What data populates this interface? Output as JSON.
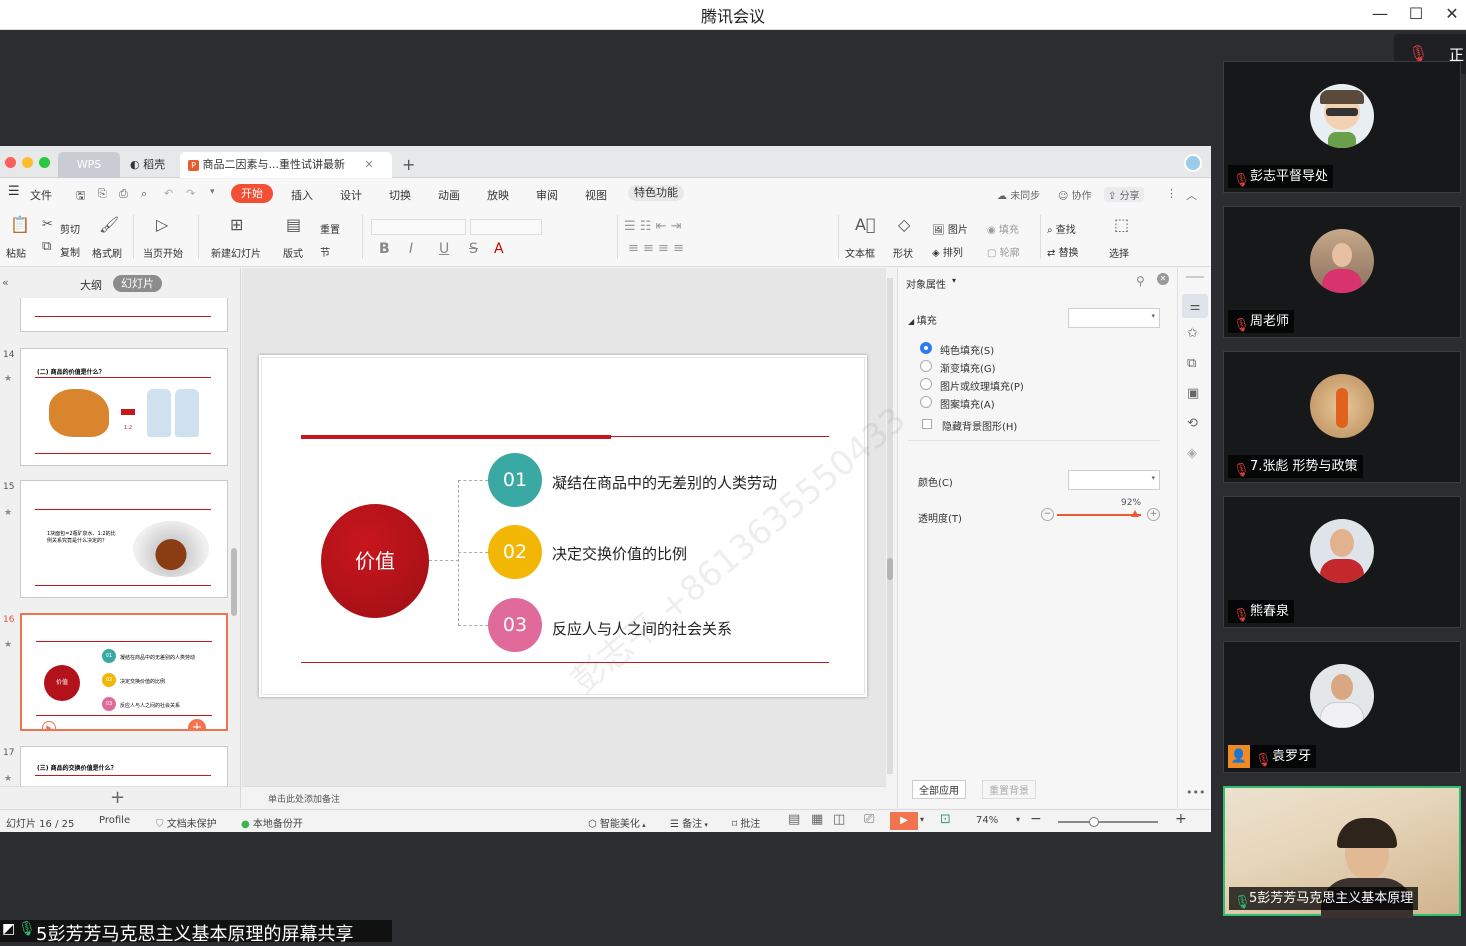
{
  "window": {
    "title": "腾讯会议",
    "minimize": "—",
    "maximize": "☐",
    "close": "✕"
  },
  "topright": {
    "label": "正"
  },
  "wps": {
    "tabs": {
      "wps": "WPS",
      "daoke": "稻壳",
      "doc": "商品二因素与...重性试讲最新",
      "add": "+"
    },
    "menu": {
      "file": "文件",
      "start": "开始",
      "insert": "插入",
      "design": "设计",
      "transition": "切换",
      "animation": "动画",
      "show": "放映",
      "review": "审阅",
      "view": "视图",
      "special": "特色功能",
      "unsync": "未同步",
      "collab": "协作",
      "share": "分享"
    },
    "toolbar": {
      "paste": "粘贴",
      "cut": "剪切",
      "copy": "复制",
      "format_painter": "格式刷",
      "from_current": "当页开始",
      "new_slide": "新建幻灯片",
      "layout": "版式",
      "reset": "重置",
      "section": "节",
      "textbox": "文本框",
      "shape": "形状",
      "picture": "图片",
      "arrange": "排列",
      "fill": "填充",
      "outline": "轮廓",
      "find": "查找",
      "replace": "替换",
      "select": "选择"
    },
    "leftpane": {
      "outline": "大纲",
      "slides": "幻灯片",
      "n14": "14",
      "n15": "15",
      "n16": "16",
      "n17": "17",
      "t14": "(二) 商品的价值是什么？",
      "t15": "1块面包=2瓶矿泉水、1:2的比例关系究竟是什么决定的？",
      "t16_center": "价值",
      "t16_1": "凝结在商品中的无差别的人类劳动",
      "t16_2": "决定交换价值的比例",
      "t16_3": "反应人与人之间的社会关系",
      "t17": "(三) 商品的交换价值是什么？",
      "ratio": "1:2"
    },
    "slide": {
      "center": "价值",
      "items": [
        {
          "num": "01",
          "text": "凝结在商品中的无差别的人类劳动",
          "color": "#3aa9a4"
        },
        {
          "num": "02",
          "text": "决定交换价值的比例",
          "color": "#f2b705"
        },
        {
          "num": "03",
          "text": "反应人与人之间的社会关系",
          "color": "#e06b9a"
        }
      ],
      "accent": "#c8161d",
      "watermark": "彭志平 +8613635550433"
    },
    "rightpane": {
      "title": "对象属性",
      "fill": "填充",
      "solid": "纯色填充(S)",
      "gradient": "渐变填充(G)",
      "picture": "图片或纹理填充(P)",
      "pattern": "图案填充(A)",
      "hide_bg": "隐藏背景图形(H)",
      "color": "颜色(C)",
      "transparency": "透明度(T)",
      "transparency_value": "92%",
      "apply_all": "全部应用",
      "reset_bg": "重置背景"
    },
    "notes": "单击此处添加备注",
    "status": {
      "slide_count": "幻灯片 16 / 25",
      "profile": "Profile",
      "protect": "文档未保护",
      "backup": "本地备份开",
      "beautify": "智能美化",
      "notes": "备注",
      "comment": "批注",
      "zoom": "74%"
    }
  },
  "participants": [
    {
      "name": "彭志平督导处"
    },
    {
      "name": "周老师"
    },
    {
      "name": "7.张彪 形势与政策"
    },
    {
      "name": "熊春泉"
    },
    {
      "name": "袁罗牙"
    },
    {
      "name": "5彭芳芳马克思主义基本原理"
    }
  ],
  "share_banner": "5彭芳芳马克思主义基本原理的屏幕共享"
}
